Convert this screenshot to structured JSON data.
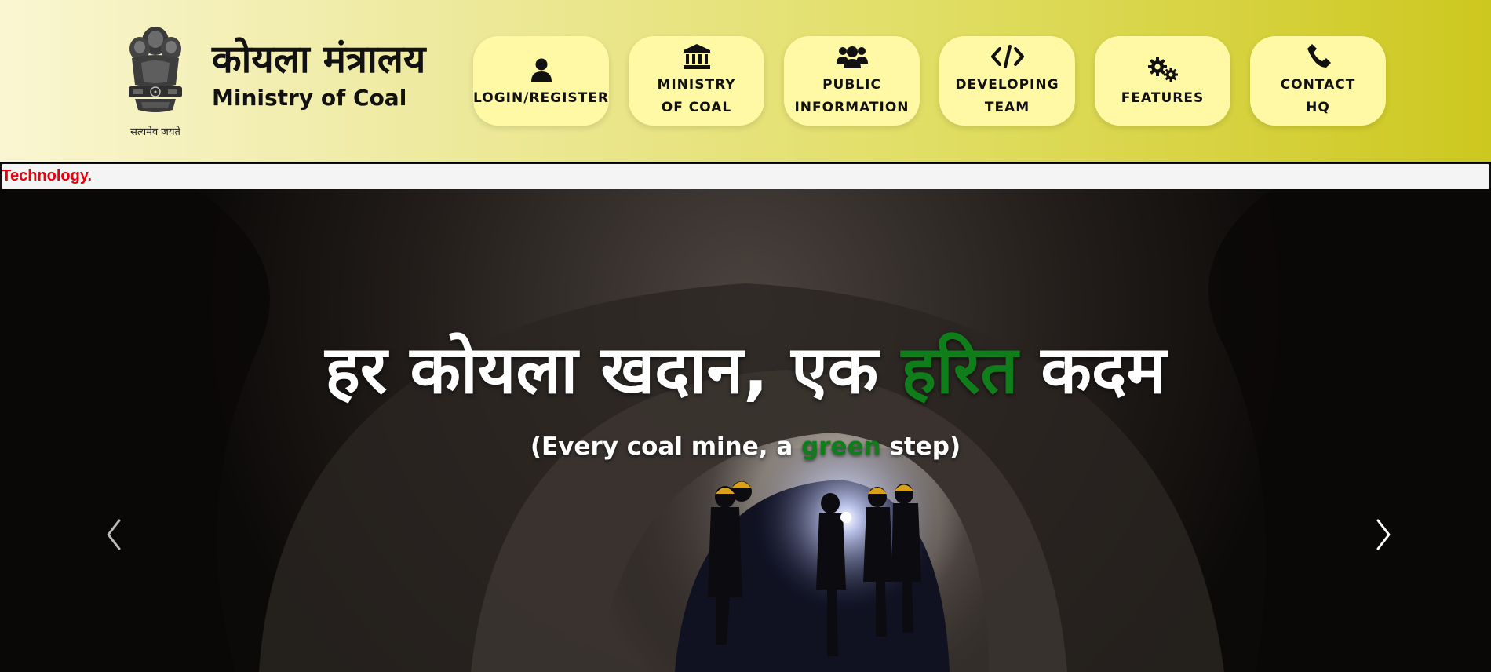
{
  "header": {
    "brand_hindi": "कोयला मंत्रालय",
    "brand_english": "Ministry of Coal",
    "emblem_motto": "सत्यमेव जयते"
  },
  "nav": {
    "items": [
      {
        "label": "LOGIN/REGISTER",
        "icon": "user-icon"
      },
      {
        "label": "MINISTRY\nOF COAL",
        "icon": "building-columns-icon"
      },
      {
        "label": "PUBLIC\nINFORMATION",
        "icon": "users-icon"
      },
      {
        "label": "DEVELOPING\nTEAM",
        "icon": "code-icon"
      },
      {
        "label": "FEATURES",
        "icon": "gears-icon"
      },
      {
        "label": "CONTACT\nHQ",
        "icon": "phone-icon"
      }
    ]
  },
  "ticker": {
    "text": "f Technology."
  },
  "hero": {
    "title_part1": "हर कोयला खदान, एक ",
    "title_green": "हरित",
    "title_part2": " कदम",
    "subtitle_part1": "(Every coal mine, a ",
    "subtitle_green": "green",
    "subtitle_part2": " step)"
  },
  "colors": {
    "header_gradient_start": "#faf6d2",
    "header_gradient_end": "#cdc81f",
    "nav_button": "#fff9a6",
    "ticker_text": "#e8000b",
    "accent_green": "#0f7d1a"
  }
}
